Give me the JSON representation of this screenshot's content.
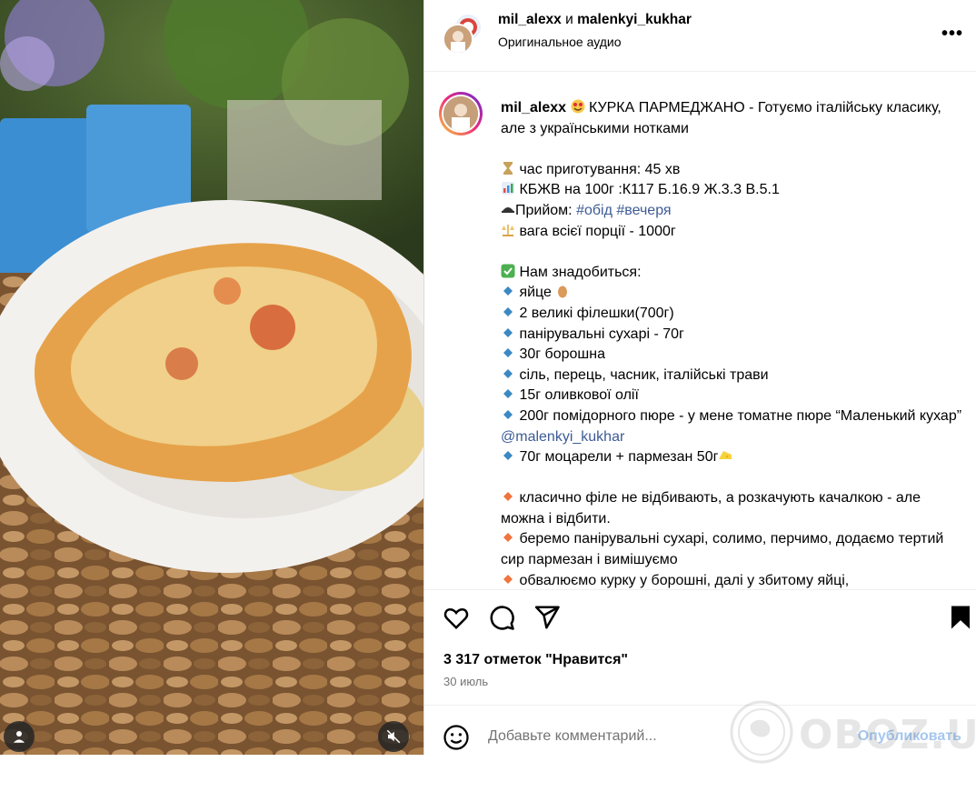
{
  "header": {
    "user1": "mil_alexx",
    "joiner": "и",
    "user2": "malenkyi_kukhar",
    "audio": "Оригинальное аудио",
    "more": "•••"
  },
  "caption": {
    "username": "mil_alexx",
    "title": " КУРКА ПАРМЕДЖАНО - Готуємо італійську класику, але з українськими нотками",
    "time": "час приготування: 45 хв",
    "kbzhv": "КБЖВ на 100г :К117 Б.16.9 Ж.3.3 В.5.1",
    "meal_prefix": "Прийом: ",
    "tag1": "#обід",
    "tag2": "#вечеря",
    "weight": "вага всієї порції - 1000г",
    "need": "Нам знадобиться:",
    "ingredients": [
      "яйце",
      "2 великі філешки(700г)",
      "панірувальні сухарі - 70г",
      "30г борошна",
      "сіль, перець, часник, італійські трави",
      "15г оливкової олії",
      "200г помідорного пюре - у мене томатне пюре “Маленький кухар” ",
      "70г моцарели + пармезан 50г"
    ],
    "mention": "@malenkyi_kukhar",
    "steps": [
      "класично філе не відбивають, а розкачують качалкою - але можна і відбити.",
      "беремо панірувальні сухарі, солимо, перчимо, додаємо тертий сир пармезан і вимішуємо",
      "обвалюємо курку у борошні, далі у збитому яйці,"
    ]
  },
  "stats": {
    "likes": "3 317 отметок \"Нравится\"",
    "date": "30 июль"
  },
  "comment": {
    "placeholder": "Добавьте комментарий...",
    "publish": "Опубликовать"
  },
  "watermark": "OBOZ.UA",
  "icons": [
    "heart-icon",
    "comment-icon",
    "share-icon",
    "bookmark-icon",
    "emoji-icon",
    "user-tag-icon",
    "mute-icon"
  ],
  "colors": {
    "link": "#3d5b95",
    "publish": "#a5c7ef",
    "muted": "#737373"
  }
}
